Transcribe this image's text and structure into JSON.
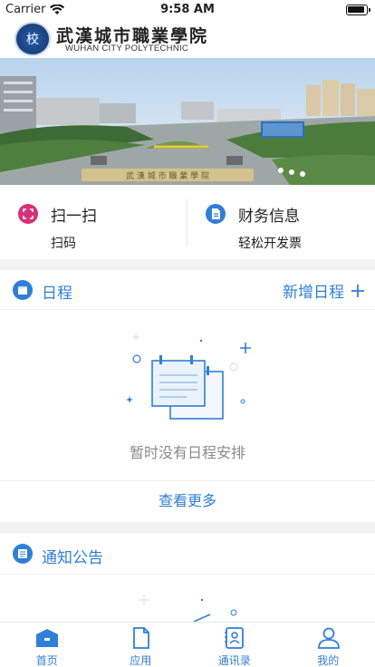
{
  "status_bar": {
    "carrier": "Carrier",
    "time": "9:58 AM"
  },
  "brand": {
    "name_cn": "武漢城市職業學院",
    "name_en": "WUHAN CITY POLYTECHNIC"
  },
  "banner": {
    "sign_text": "武 漢 城 市 職 業 學 院"
  },
  "quick_actions": [
    {
      "title": "扫一扫",
      "subtitle": "扫码",
      "icon": "scan-icon",
      "color": "#d6307a"
    },
    {
      "title": "财务信息",
      "subtitle": "轻松开发票",
      "icon": "invoice-icon",
      "color": "#2f7fd6"
    }
  ],
  "schedule": {
    "title": "日程",
    "add_label": "新增日程",
    "empty_text": "暂时没有日程安排",
    "view_more": "查看更多"
  },
  "notices": {
    "title": "通知公告"
  },
  "tabs": [
    {
      "label": "首页",
      "icon": "home-icon"
    },
    {
      "label": "应用",
      "icon": "app-icon"
    },
    {
      "label": "通讯录",
      "icon": "contacts-icon"
    },
    {
      "label": "我的",
      "icon": "profile-icon"
    }
  ],
  "accent_color": "#2f7fd6"
}
